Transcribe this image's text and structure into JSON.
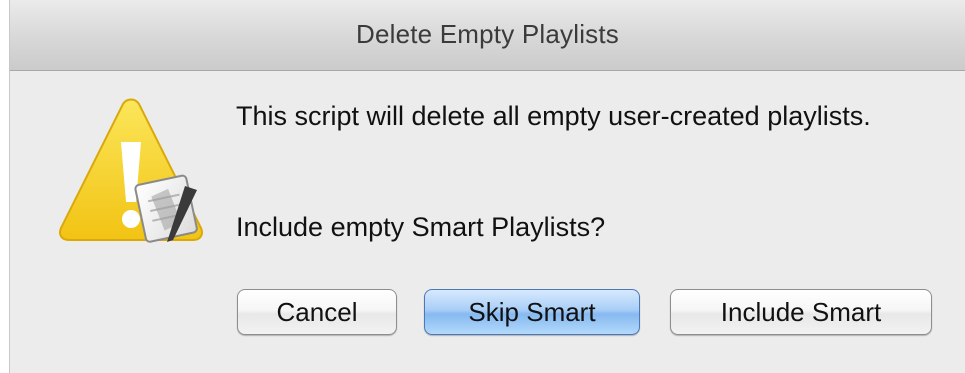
{
  "window": {
    "title": "Delete Empty Playlists"
  },
  "alert": {
    "message": "This script will delete all empty user-created playlists.",
    "question": "Include empty Smart Playlists?",
    "icon": "warning-triangle-with-script-icon"
  },
  "buttons": {
    "cancel": "Cancel",
    "skip_smart": "Skip Smart",
    "include_smart": "Include Smart",
    "default_button": "skip_smart"
  },
  "colors": {
    "warning_yellow": "#f7cf1b",
    "default_button_blue": "#a9cff6",
    "dialog_background": "#ececec"
  }
}
